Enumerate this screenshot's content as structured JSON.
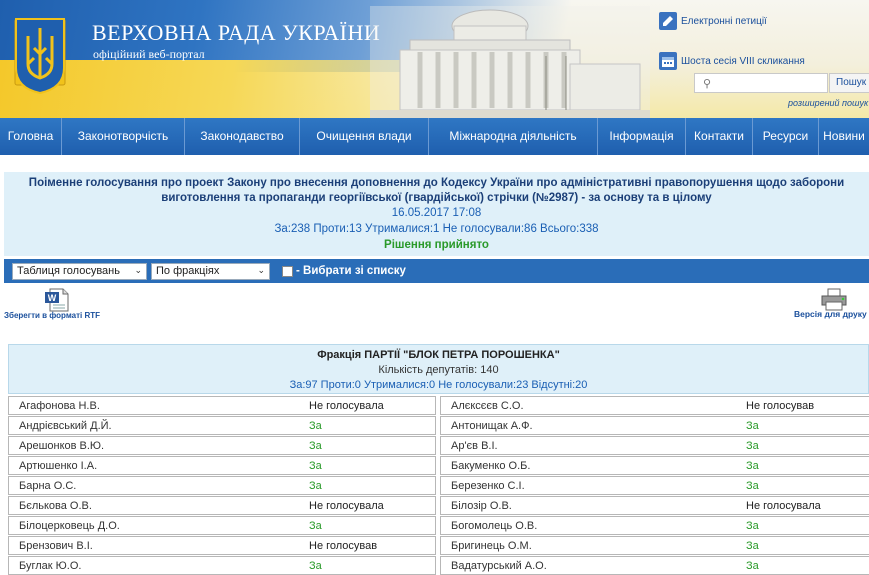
{
  "header": {
    "title": "ВЕРХОВНА РАДА УКРАЇНИ",
    "subtitle": "офіційний веб-портал",
    "petitions_link": "Електронні петиції",
    "session_link": "Шоста сесія VIII скликання",
    "search": {
      "placeholder": "",
      "button": "Пошук",
      "advanced": "розширений пошук"
    }
  },
  "nav": {
    "items": [
      {
        "label": "Головна"
      },
      {
        "label": "Законотворчість"
      },
      {
        "label": "Законодавство"
      },
      {
        "label": "Очищення влади"
      },
      {
        "label": "Міжнародна діяльність"
      },
      {
        "label": "Інформація"
      },
      {
        "label": "Контакти"
      },
      {
        "label": "Ресурси"
      },
      {
        "label": "Новини"
      }
    ]
  },
  "vote": {
    "title": "Поіменне голосування про проект Закону про внесення доповнення до Кодексу України про адміністративні правопорушення щодо заборони виготовлення та пропаганди георгіївської (гвардійської) стрічки (№2987) - за основу та в цілому",
    "datetime": "16.05.2017 17:08",
    "stats": "За:238 Проти:13 Утрималися:1 Не голосували:86 Всього:338",
    "result": "Рішення прийнято"
  },
  "toolbar": {
    "view_select": "Таблиця голосувань",
    "group_select": "По фракціях",
    "select_from_list": "- Вибрати зі списку"
  },
  "actions": {
    "save_rtf": "Зберегти в форматі RTF",
    "print_version": "Версія для друку"
  },
  "faction": {
    "name": "Фракція ПАРТІЇ \"БЛОК ПЕТРА ПОРОШЕНКА\"",
    "count": "Кількість депутатів: 140",
    "stats": "За:97 Проти:0 Утрималися:0 Не голосували:23 Відсутні:20"
  },
  "votes": [
    {
      "left": {
        "name": "Агафонова Н.В.",
        "vote": "Не голосувала"
      },
      "right": {
        "name": "Алєксєєв С.О.",
        "vote": "Не голосував"
      }
    },
    {
      "left": {
        "name": "Андрієвський Д.Й.",
        "vote": "За"
      },
      "right": {
        "name": "Антонищак А.Ф.",
        "vote": "За"
      }
    },
    {
      "left": {
        "name": "Арешонков В.Ю.",
        "vote": "За"
      },
      "right": {
        "name": "Ар'єв В.І.",
        "vote": "За"
      }
    },
    {
      "left": {
        "name": "Артюшенко І.А.",
        "vote": "За"
      },
      "right": {
        "name": "Бакуменко О.Б.",
        "vote": "За"
      }
    },
    {
      "left": {
        "name": "Барна О.С.",
        "vote": "За"
      },
      "right": {
        "name": "Березенко С.І.",
        "vote": "За"
      }
    },
    {
      "left": {
        "name": "Бєлькова О.В.",
        "vote": "Не голосувала"
      },
      "right": {
        "name": "Білозір О.В.",
        "vote": "Не голосувала"
      }
    },
    {
      "left": {
        "name": "Білоцерковець Д.О.",
        "vote": "За"
      },
      "right": {
        "name": "Богомолець О.В.",
        "vote": "За"
      }
    },
    {
      "left": {
        "name": "Брензович В.І.",
        "vote": "Не голосував"
      },
      "right": {
        "name": "Бригинець О.М.",
        "vote": "За"
      }
    },
    {
      "left": {
        "name": "Буглак Ю.О.",
        "vote": "За"
      },
      "right": {
        "name": "Вадатурський А.О.",
        "vote": "За"
      }
    }
  ],
  "colors": {
    "brand_blue": "#1f5fae",
    "info_bg": "#dff0f9",
    "yes_green": "#2a9a2a",
    "flag_yellow": "#f4c82a"
  }
}
